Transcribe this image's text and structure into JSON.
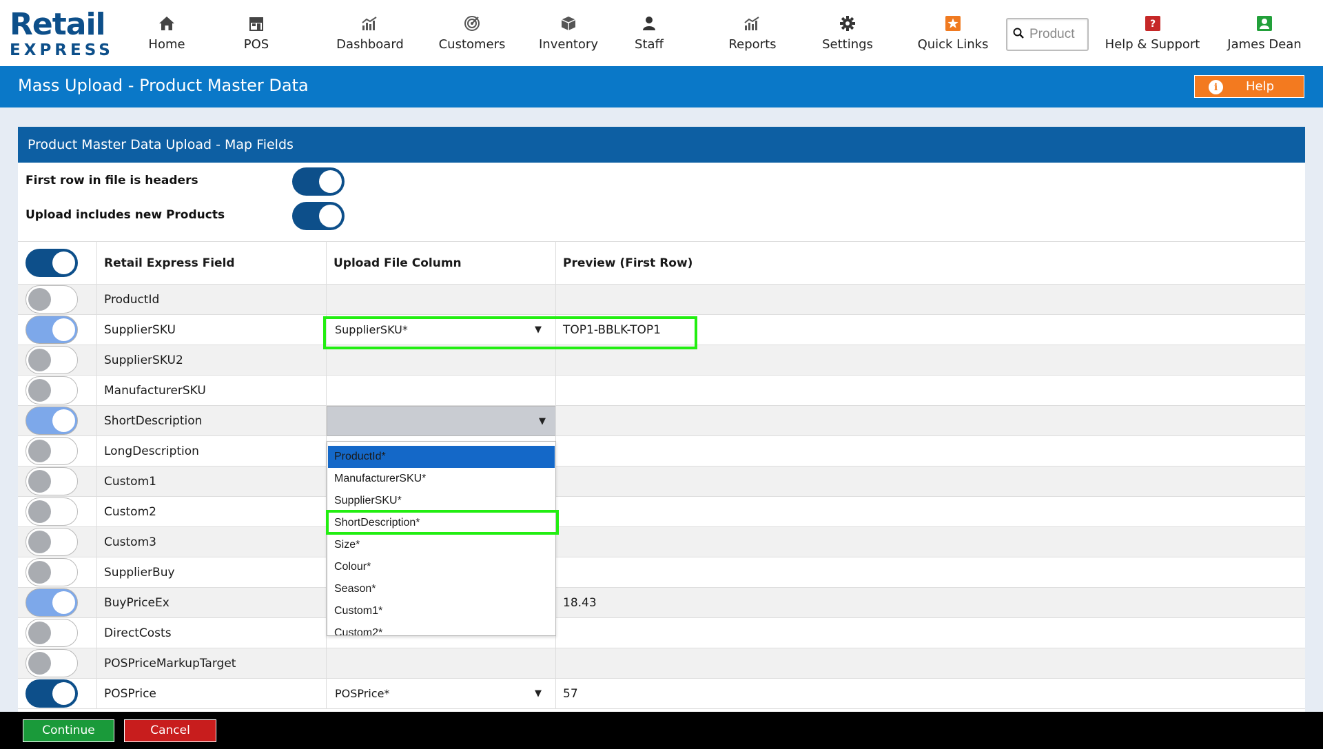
{
  "brand": {
    "logo_top": "Retail",
    "logo_bottom": "EXPRESS"
  },
  "nav": [
    {
      "label": "Home",
      "icon": "home-icon"
    },
    {
      "label": "POS",
      "icon": "store-icon"
    },
    {
      "label": "Dashboard",
      "icon": "dashboard-chart-icon"
    },
    {
      "label": "Customers",
      "icon": "target-icon"
    },
    {
      "label": "Inventory",
      "icon": "box-icon"
    },
    {
      "label": "Staff",
      "icon": "person-icon"
    },
    {
      "label": "Reports",
      "icon": "reports-chart-icon"
    },
    {
      "label": "Settings",
      "icon": "gear-icon"
    },
    {
      "label": "Quick Links",
      "icon": "star-icon"
    },
    {
      "label": "Help & Support",
      "icon": "question-icon"
    },
    {
      "label": "James Dean",
      "icon": "user-icon"
    }
  ],
  "search": {
    "placeholder": "Product"
  },
  "page": {
    "title": "Mass Upload - Product Master Data",
    "help_label": "Help"
  },
  "panel": {
    "header": "Product Master Data Upload - Map Fields",
    "option_headers": "First row in file is headers",
    "option_new_products": "Upload includes new Products"
  },
  "table": {
    "columns": [
      "Retail Express Field",
      "Upload File Column",
      "Preview (First Row)"
    ],
    "rows": [
      {
        "field": "ProductId",
        "upload": "",
        "preview": "",
        "enabled": false
      },
      {
        "field": "SupplierSKU",
        "upload": "SupplierSKU*",
        "preview": "TOP1-BBLK-TOP1",
        "enabled": true
      },
      {
        "field": "SupplierSKU2",
        "upload": "",
        "preview": "",
        "enabled": false
      },
      {
        "field": "ManufacturerSKU",
        "upload": "",
        "preview": "",
        "enabled": false
      },
      {
        "field": "ShortDescription",
        "upload": "",
        "preview": "",
        "enabled": true
      },
      {
        "field": "LongDescription",
        "upload": "",
        "preview": "",
        "enabled": false
      },
      {
        "field": "Custom1",
        "upload": "",
        "preview": "",
        "enabled": false
      },
      {
        "field": "Custom2",
        "upload": "",
        "preview": "",
        "enabled": false
      },
      {
        "field": "Custom3",
        "upload": "",
        "preview": "",
        "enabled": false
      },
      {
        "field": "SupplierBuy",
        "upload": "",
        "preview": "",
        "enabled": false
      },
      {
        "field": "BuyPriceEx",
        "upload": "",
        "preview": "18.43",
        "enabled": true
      },
      {
        "field": "DirectCosts",
        "upload": "",
        "preview": "",
        "enabled": false
      },
      {
        "field": "POSPriceMarkupTarget",
        "upload": "",
        "preview": "",
        "enabled": false
      },
      {
        "field": "POSPrice",
        "upload": "POSPrice*",
        "preview": "57",
        "enabled": true
      }
    ]
  },
  "dropdown": {
    "options": [
      "ProductId*",
      "ManufacturerSKU*",
      "SupplierSKU*",
      "ShortDescription*",
      "Size*",
      "Colour*",
      "Season*",
      "Custom1*",
      "Custom2*"
    ],
    "highlighted": "ProductId*"
  },
  "footer": {
    "continue_label": "Continue",
    "cancel_label": "Cancel"
  },
  "colors": {
    "accent_blue": "#0a78c8",
    "header_blue": "#0d5fa3",
    "help_orange": "#f37a1f",
    "continue_green": "#1a9a3a",
    "cancel_red": "#c81d1d",
    "highlight_green": "#22ee11"
  }
}
